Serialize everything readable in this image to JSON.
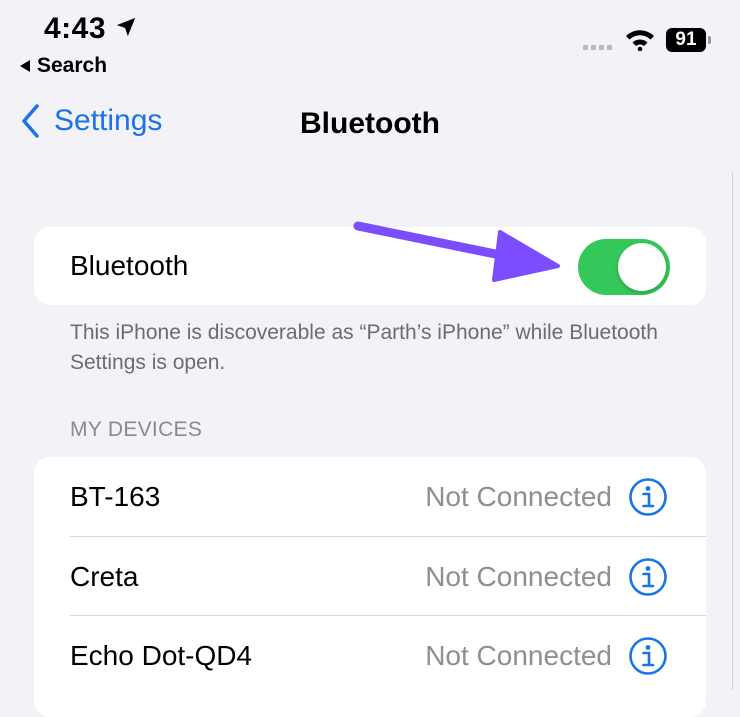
{
  "status_bar": {
    "time": "4:43",
    "back_app": "Search",
    "battery": "91"
  },
  "nav": {
    "back_label": "Settings",
    "title": "Bluetooth"
  },
  "bluetooth": {
    "label": "Bluetooth",
    "enabled": true,
    "footnote": "This iPhone is discoverable as “Parth’s iPhone” while Bluetooth Settings is open."
  },
  "my_devices": {
    "header": "MY DEVICES",
    "items": [
      {
        "name": "BT-163",
        "status": "Not Connected"
      },
      {
        "name": "Creta",
        "status": "Not Connected"
      },
      {
        "name": "Echo Dot-QD4",
        "status": "Not Connected"
      }
    ]
  },
  "colors": {
    "accent": "#1a73e8",
    "toggle_on": "#34c759",
    "annotation_arrow": "#7b4dff"
  }
}
